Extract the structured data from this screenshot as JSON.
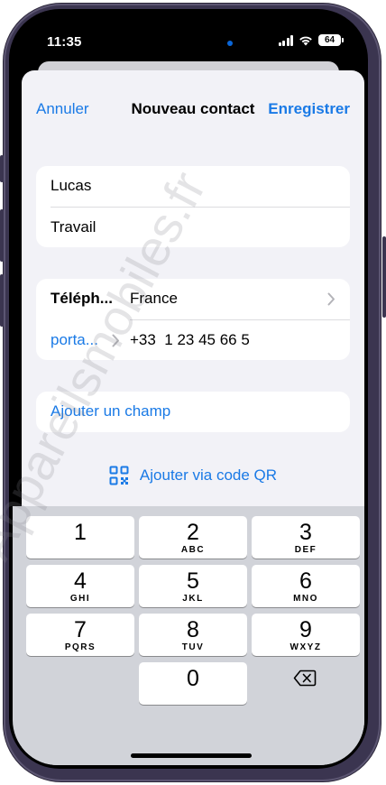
{
  "status_bar": {
    "time": "11:35",
    "battery": "64"
  },
  "nav": {
    "cancel": "Annuler",
    "title": "Nouveau contact",
    "save": "Enregistrer"
  },
  "name_fields": {
    "first_name": "Lucas",
    "company": "Travail"
  },
  "phone": {
    "label_field": "Téléph...",
    "country": "France",
    "type_label": "porta...",
    "number": "+33  1 23 45 66 5"
  },
  "add_field": "Ajouter un champ",
  "add_qr": "Ajouter via code QR",
  "keypad": [
    {
      "num": "1",
      "letters": ""
    },
    {
      "num": "2",
      "letters": "ABC"
    },
    {
      "num": "3",
      "letters": "DEF"
    },
    {
      "num": "4",
      "letters": "GHI"
    },
    {
      "num": "5",
      "letters": "JKL"
    },
    {
      "num": "6",
      "letters": "MNO"
    },
    {
      "num": "7",
      "letters": "PQRS"
    },
    {
      "num": "8",
      "letters": "TUV"
    },
    {
      "num": "9",
      "letters": "WXYZ"
    },
    {
      "num": "0",
      "letters": ""
    }
  ],
  "icons": {
    "qr": "qr-code-icon",
    "delete": "backspace-icon",
    "chevron": "chevron-right-icon"
  },
  "colors": {
    "accent": "#1a7ae6",
    "frame": "#3b3550",
    "sheet_bg": "#f2f2f7",
    "keyboard_bg": "#d1d3d9"
  },
  "watermark": "Appareilsmobiles.fr"
}
